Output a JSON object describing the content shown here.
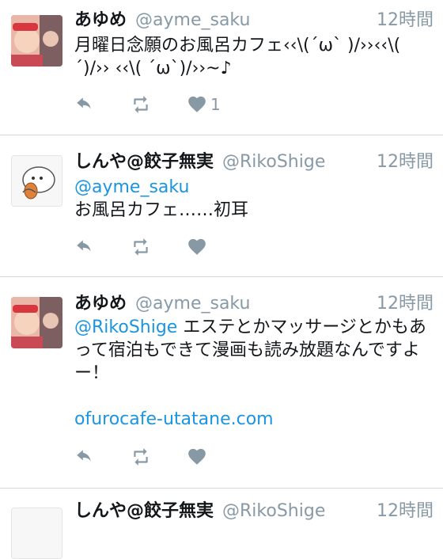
{
  "tweets": [
    {
      "name": "あゆめ",
      "handle": "@ayme_saku",
      "time": "12時間",
      "text": "月曜日念願のお風呂カフェ‹‹\\(´ω` )/››‹‹\\(  ´)/›› ‹‹\\( ´ω`)/››~♪",
      "like_count": "1"
    },
    {
      "name": "しんや@餃子無実",
      "handle": "@RikoShige",
      "time": "12時間",
      "mention": "@ayme_saku",
      "text": "お風呂カフェ……初耳"
    },
    {
      "name": "あゆめ",
      "handle": "@ayme_saku",
      "time": "12時間",
      "mention": "@RikoShige",
      "text": "エステとかマッサージとかもあって宿泊もできて漫画も読み放題なんですよー！",
      "link": "ofurocafe-utatane.com"
    },
    {
      "name": "しんや@餃子無実",
      "handle": "@RikoShige",
      "time": "12時間"
    }
  ],
  "icons": {
    "reply": "reply-icon",
    "retweet": "retweet-icon",
    "like": "heart-icon"
  },
  "colors": {
    "name": "#14171a",
    "secondary": "#8899a6",
    "link": "#1b95e0",
    "divider": "#d6d9dc"
  }
}
